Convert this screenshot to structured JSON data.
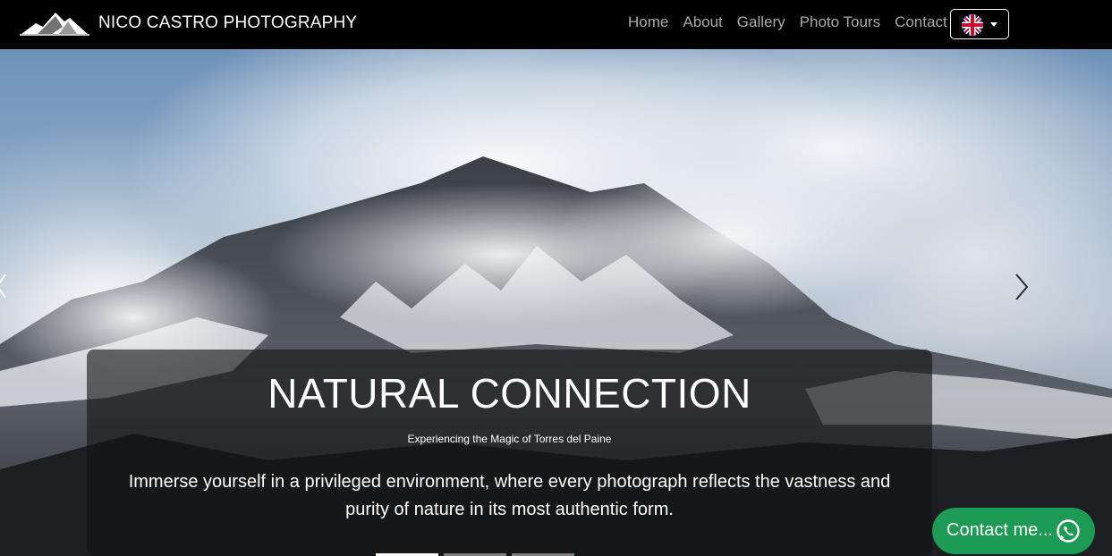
{
  "navbar": {
    "brand": "NICO CASTRO PHOTOGRAPHY",
    "logo_icon": "mountain-logo-icon",
    "links": [
      {
        "label": "Home"
      },
      {
        "label": "About"
      },
      {
        "label": "Gallery"
      },
      {
        "label": "Photo Tours"
      },
      {
        "label": "Contact"
      }
    ],
    "language": {
      "icon": "uk-flag-icon",
      "selected": "English"
    }
  },
  "carousel": {
    "caption": {
      "title": "NATURAL CONNECTION",
      "subtitle": "Experiencing the Magic of Torres del Paine",
      "body": "Immerse yourself in a privileged environment, where every photograph reflects the vastness and purity of nature in its most authentic form."
    },
    "active_index": 0,
    "slide_count": 3
  },
  "whatsapp_button": {
    "label": "Contact me...",
    "icon": "whatsapp-icon",
    "color": "#1d9b55"
  },
  "colors": {
    "navbar_bg": "#000000",
    "nav_link": "#a9a9a9",
    "brand_text": "#ffffff"
  }
}
